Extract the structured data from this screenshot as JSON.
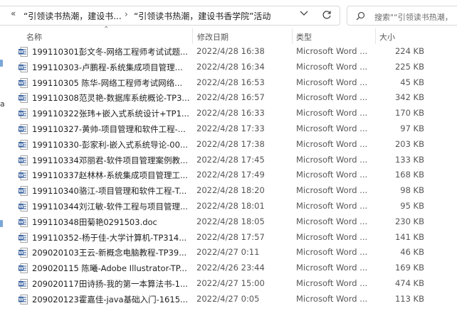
{
  "address_bar": {
    "back_glyph": "«",
    "crumbs": [
      "“引领读书热潮，建设书...",
      "“引领读书热潮，建设书香学院”活动"
    ],
    "separator": "›"
  },
  "search": {
    "placeholder": "搜索\"“引领读书热潮，"
  },
  "columns": {
    "name": "名称",
    "date": "修改日期",
    "type": "类型",
    "size": "大小"
  },
  "nav_glyph": "a",
  "colors": {
    "word_icon": "#2b579a",
    "header_divider": "#e5e5e5"
  },
  "files": [
    {
      "name": "199110301彭文冬-网络工程师考试试题...",
      "date": "2022/4/28 16:38",
      "type": "Microsoft Word ...",
      "size": "224 KB"
    },
    {
      "name": "199110303-卢鹏程-系统集成项目管理...",
      "date": "2022/4/28 16:34",
      "type": "Microsoft Word ...",
      "size": "225 KB"
    },
    {
      "name": "199110305 陈华-网络工程师考试网络...",
      "date": "2022/4/28 16:53",
      "type": "Microsoft Word ...",
      "size": "45 KB"
    },
    {
      "name": "199110308范灵艳-数据库系统概论-TP3...",
      "date": "2022/4/28 16:57",
      "type": "Microsoft Word ...",
      "size": "342 KB"
    },
    {
      "name": "199110322张玮+嵌入式系统设计+TP1...",
      "date": "2022/4/28 16:33",
      "type": "Microsoft Word ...",
      "size": "170 KB"
    },
    {
      "name": "199110327-黄帅-项目管理和软件工程-...",
      "date": "2022/4/28 17:33",
      "type": "Microsoft Word ...",
      "size": "97 KB"
    },
    {
      "name": "199110330-彭家利-嵌入式系统导论-00...",
      "date": "2022/4/28 17:38",
      "type": "Microsoft Word ...",
      "size": "203 KB"
    },
    {
      "name": "199110334邓丽君-软件项目管理案例教...",
      "date": "2022/4/28 17:45",
      "type": "Microsoft Word ...",
      "size": "133 KB"
    },
    {
      "name": "199110337赵林林-系统集成项目管理工...",
      "date": "2022/4/28 17:49",
      "type": "Microsoft Word ...",
      "size": "168 KB"
    },
    {
      "name": "199110340骆江-项目管理和软件工程-T...",
      "date": "2022/4/28 18:20",
      "type": "Microsoft Word ...",
      "size": "98 KB"
    },
    {
      "name": "199110344刘江敏-软件工程与项目管理...",
      "date": "2022/4/28 18:01",
      "type": "Microsoft Word ...",
      "size": "95 KB"
    },
    {
      "name": "199110348田菊艳0291503.doc",
      "date": "2022/4/28 18:05",
      "type": "Microsoft Word ...",
      "size": "230 KB"
    },
    {
      "name": "199110352-杨于佳-大学计算机-TP314...",
      "date": "2022/4/28 17:57",
      "type": "Microsoft Word ...",
      "size": "141 KB"
    },
    {
      "name": "209020103王云-新概念电脑教程-TP39...",
      "date": "2022/4/27 0:11",
      "type": "Microsoft Word ...",
      "size": "46 KB"
    },
    {
      "name": "209020115 陈曦-Adobe Illustrator-TP...",
      "date": "2022/4/26 23:44",
      "type": "Microsoft Word ...",
      "size": "169 KB"
    },
    {
      "name": "209020117田诗扬-我的第一本算法书-1...",
      "date": "2022/4/27 15:00",
      "type": "Microsoft Word ...",
      "size": "474 KB"
    },
    {
      "name": "209020123霍嘉佳-java基础入门-1615...",
      "date": "2022/4/27 0:05",
      "type": "Microsoft Word ...",
      "size": "113 KB"
    }
  ]
}
